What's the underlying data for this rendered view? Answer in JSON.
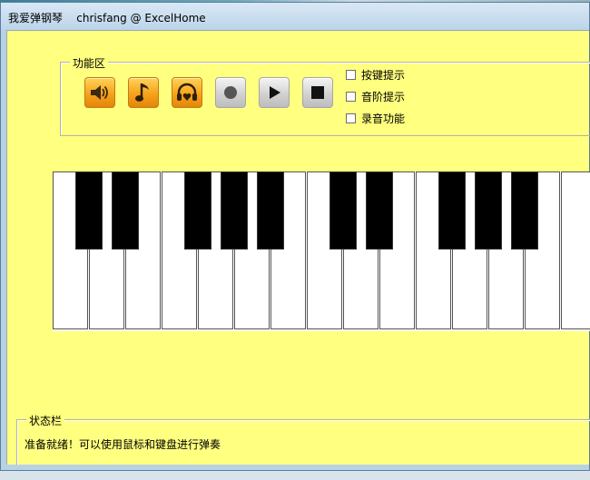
{
  "window": {
    "title": "我爱弹钢琴    chrisfang @ ExcelHome"
  },
  "function_area": {
    "label": "功能区",
    "buttons": [
      {
        "name": "volume-button",
        "icon": "speaker-icon"
      },
      {
        "name": "music-note-button",
        "icon": "music-note-icon"
      },
      {
        "name": "headphones-button",
        "icon": "headphones-heart-icon"
      },
      {
        "name": "record-button",
        "icon": "record-icon"
      },
      {
        "name": "play-button",
        "icon": "play-icon"
      },
      {
        "name": "stop-button",
        "icon": "stop-icon"
      }
    ],
    "checkboxes": [
      {
        "label": "按键提示",
        "checked": false
      },
      {
        "label": "音阶提示",
        "checked": false
      },
      {
        "label": "录音功能",
        "checked": false
      }
    ]
  },
  "piano": {
    "white_key_count": 15,
    "black_key_after_white": [
      0,
      1,
      3,
      4,
      5,
      7,
      8,
      10,
      11,
      12
    ]
  },
  "status_bar": {
    "label": "状态栏",
    "message": "准备就绪！可以使用鼠标和键盘进行弹奏"
  },
  "colors": {
    "client_bg": "#ffff80",
    "accent_orange": "#f7a21b"
  }
}
